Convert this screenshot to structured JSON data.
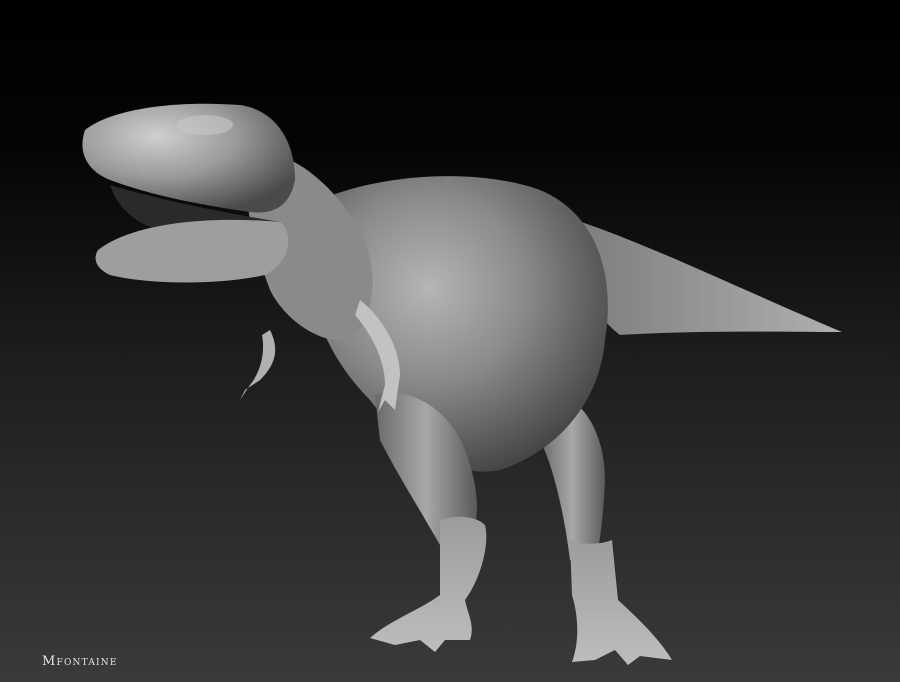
{
  "image": {
    "subject": "clay-render-t-rex-sculpt",
    "background_colors": [
      "#000000",
      "#2e2e2e",
      "#3a3a3a"
    ],
    "model_color": "#8f8f8f"
  },
  "signature": {
    "text": "Mfontaine"
  }
}
